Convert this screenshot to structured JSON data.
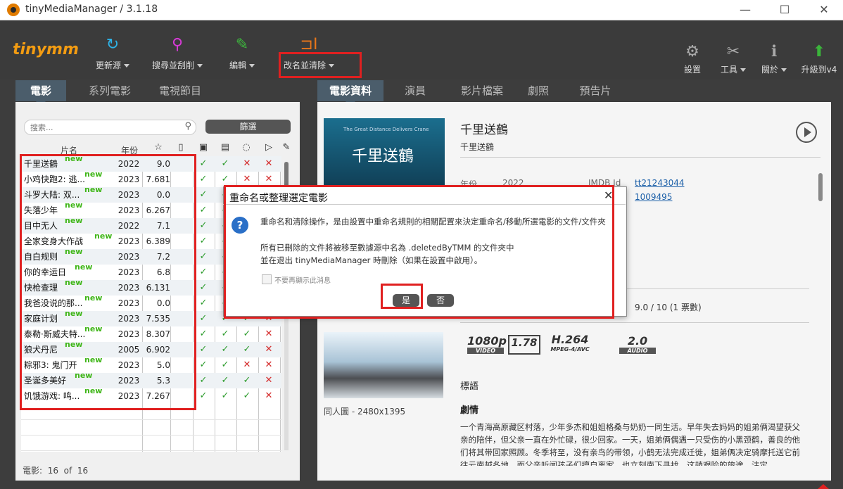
{
  "window": {
    "title": "tinyMediaManager / 3.1.18"
  },
  "logo": "tinymm",
  "toolbar": {
    "items": [
      {
        "label": "更新源",
        "icon": "refresh-icon",
        "color": "#2eb5ea"
      },
      {
        "label": "搜尋並刮削",
        "icon": "search-key-icon",
        "color": "#d63ad6"
      },
      {
        "label": "編輯",
        "icon": "edit-icon",
        "color": "#3db83d"
      },
      {
        "label": "改名並清除",
        "icon": "rename-icon",
        "color": "#e8761a"
      }
    ],
    "right_items": [
      {
        "label": "設置",
        "icon": "gear-icon"
      },
      {
        "label": "工具",
        "icon": "tools-icon"
      },
      {
        "label": "關於",
        "icon": "info-icon"
      },
      {
        "label": "升級到v4",
        "icon": "upgrade-arrow-icon",
        "color": "#3bb53b"
      }
    ]
  },
  "left_tabs": [
    "電影",
    "系列電影",
    "電視節目"
  ],
  "right_tabs": [
    "電影資料",
    "演員",
    "影片檔案",
    "劇照",
    "預告片"
  ],
  "search": {
    "placeholder": "搜索..."
  },
  "filter_label": "篩選",
  "table": {
    "col_title": "片名",
    "col_year": "年份",
    "new_tag": "new",
    "movies": [
      {
        "title": "千里送鶴",
        "year": "2022",
        "rating": "9.0",
        "flags": [
          "ok",
          "ok",
          "no",
          "no",
          "no"
        ]
      },
      {
        "title": "小鸡快跑2: 逃...",
        "year": "2023",
        "rating": "7.681",
        "flags": [
          "ok",
          "ok",
          "no",
          "no",
          "no"
        ]
      },
      {
        "title": "斗罗大陆: 双...",
        "year": "2023",
        "rating": "0.0",
        "flags": [
          "ok",
          "ok",
          "no",
          "no",
          "no"
        ]
      },
      {
        "title": "失落少年",
        "year": "2023",
        "rating": "6.267",
        "flags": [
          "ok",
          "ok",
          "no",
          "no",
          "no"
        ]
      },
      {
        "title": "目中无人",
        "year": "2022",
        "rating": "7.1",
        "flags": [
          "ok",
          "ok",
          "no",
          "no",
          "no"
        ]
      },
      {
        "title": "全家变身大作战",
        "year": "2023",
        "rating": "6.389",
        "flags": [
          "ok",
          "ok",
          "no",
          "no",
          "no"
        ]
      },
      {
        "title": "自白规则",
        "year": "2023",
        "rating": "7.2",
        "flags": [
          "ok",
          "ok",
          "no",
          "no",
          "no"
        ]
      },
      {
        "title": "你的幸运日",
        "year": "2023",
        "rating": "6.8",
        "flags": [
          "ok",
          "ok",
          "no",
          "no",
          "no"
        ]
      },
      {
        "title": "快枪查理",
        "year": "2023",
        "rating": "6.131",
        "flags": [
          "ok",
          "ok",
          "no",
          "no",
          "no"
        ]
      },
      {
        "title": "我爸没说的那...",
        "year": "2023",
        "rating": "0.0",
        "flags": [
          "ok",
          "ok",
          "no",
          "no",
          "no"
        ]
      },
      {
        "title": "家庭计划",
        "year": "2023",
        "rating": "7.535",
        "flags": [
          "ok",
          "ok",
          "ok",
          "no",
          "no"
        ]
      },
      {
        "title": "泰勒·斯威夫特...",
        "year": "2023",
        "rating": "8.307",
        "flags": [
          "ok",
          "ok",
          "ok",
          "no",
          "no"
        ]
      },
      {
        "title": "狼犬丹尼",
        "year": "2005",
        "rating": "6.902",
        "flags": [
          "ok",
          "ok",
          "ok",
          "no",
          "no"
        ]
      },
      {
        "title": "粽邪3: 鬼门开",
        "year": "2023",
        "rating": "5.0",
        "flags": [
          "ok",
          "ok",
          "no",
          "no",
          "no"
        ]
      },
      {
        "title": "圣诞多美好",
        "year": "2023",
        "rating": "5.3",
        "flags": [
          "ok",
          "ok",
          "ok",
          "no",
          "no"
        ]
      },
      {
        "title": "饥饿游戏: 鸣...",
        "year": "2023",
        "rating": "7.267",
        "flags": [
          "ok",
          "ok",
          "ok",
          "no",
          "no"
        ]
      }
    ]
  },
  "status": {
    "label": "電影:",
    "shown": "16",
    "of": "of",
    "total": "16"
  },
  "detail": {
    "title": "千里送鶴",
    "original_title": "千里送鶴",
    "poster_title": "千里送鶴",
    "poster_subtitle": "The Great Distance Delivers Crane",
    "year_label": "年份",
    "year_value": "2022",
    "imdb_label": "IMDB Id",
    "imdb_value": "tt21243044",
    "tmdb_value": "1009495",
    "rating_text": "9.0 / 10  (1 票數)",
    "fanart_label": "同人圖 - 2480x1395",
    "video_res": "1080p",
    "video_label": "VIDEO",
    "aspect": "1.78",
    "codec": "H.264",
    "codec_label": "MPEG-4/AVC",
    "audio_ch": "2.0",
    "audio_label": "AUDIO",
    "tags_label": "標語",
    "plot_label": "劇情",
    "plot": "一个青海高原藏区村落，少年多杰和姐姐格桑与奶奶一同生活。早年失去妈妈的姐弟俩渴望获父亲的陪伴，但父亲一直在外忙碌，很少回家。一天，姐弟俩偶遇一只受伤的小黑颈鹤，善良的他们将其带回家照顾。冬季将至，没有亲鸟的带领，小鹤无法完成迁徙，姐弟俩决定骑摩托送它前往云南越冬地。而父亲听闻孩子们擅自离家，也立刻南下寻找。这趟艰险的旅途，注定"
  },
  "dialog": {
    "title": "重命名或整理選定電影",
    "line1": "重命名和清除操作，是由設置中重命名規則的相關配置來決定重命名/移動所選電影的文件/文件夾",
    "line2": "所有已刪除的文件將被移至數據源中名為 .deletedByTMM 的文件夾中",
    "line3": "並在退出 tinyMediaManager 時刪除（如果在設置中啟用）。",
    "checkbox_label": "不要再顯示此消息",
    "yes": "是",
    "no": "否"
  }
}
